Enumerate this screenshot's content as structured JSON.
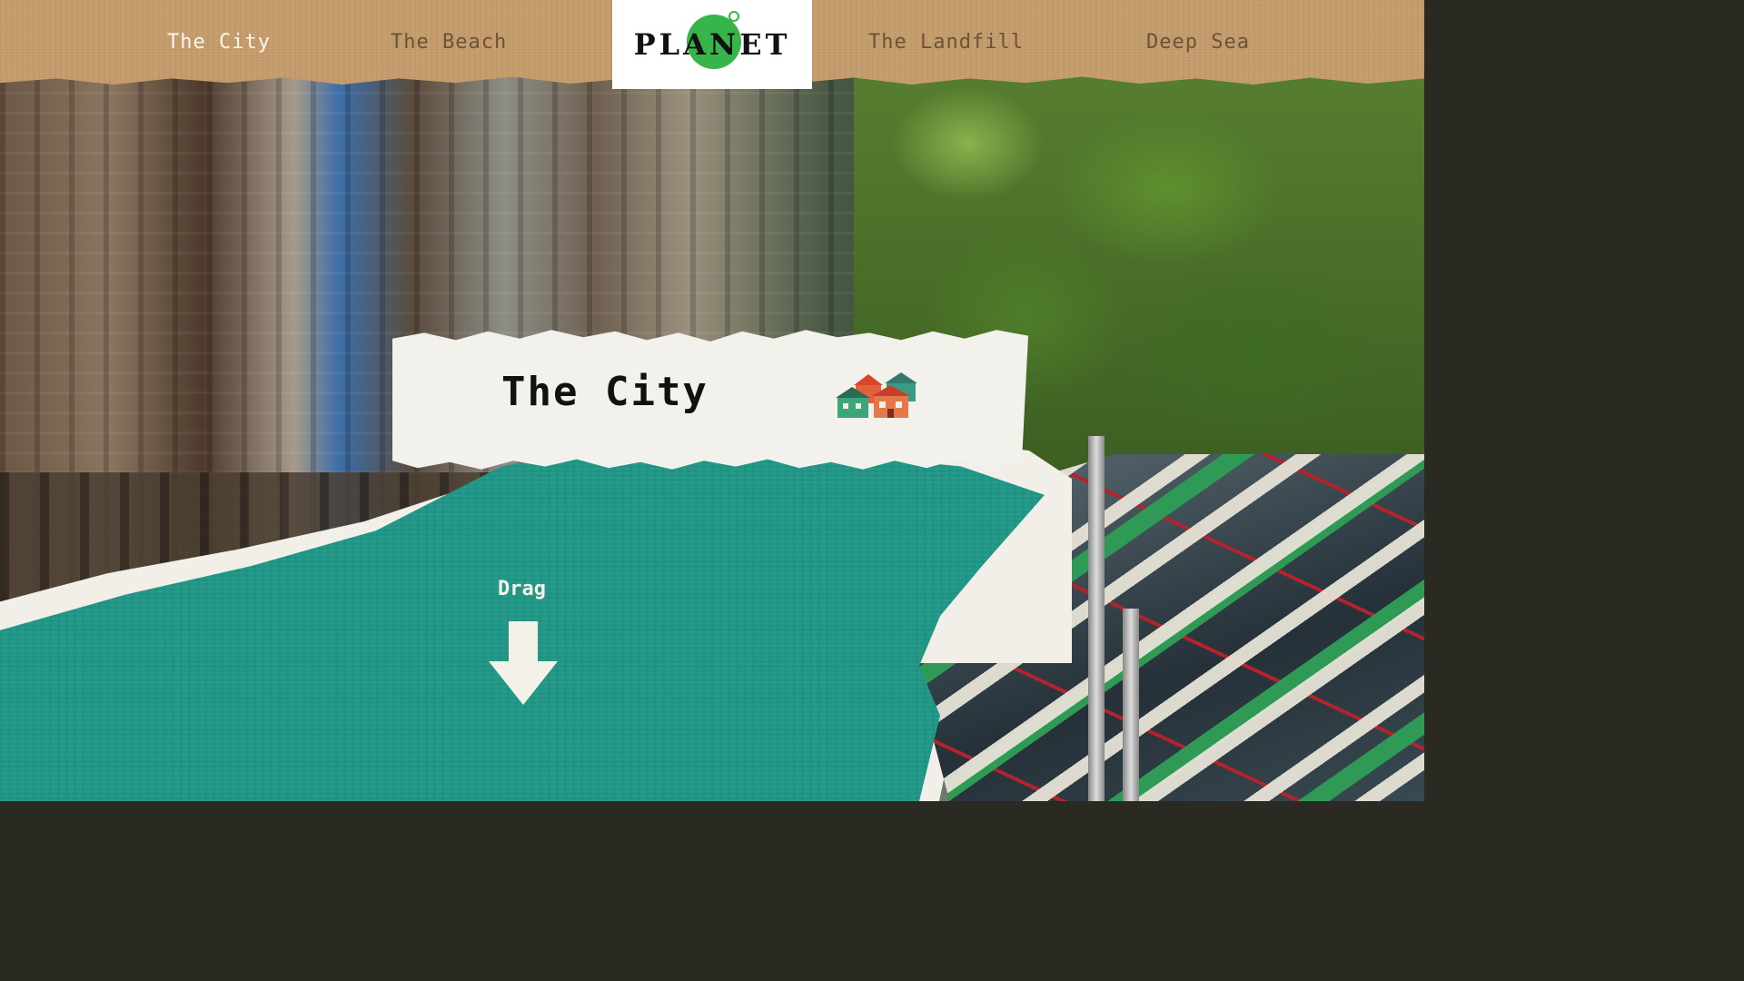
{
  "nav": {
    "items": [
      {
        "label": "The City",
        "active": true
      },
      {
        "label": "The Beach",
        "active": false
      },
      {
        "label": "The Landfill",
        "active": false
      },
      {
        "label": "Deep Sea",
        "active": false
      }
    ]
  },
  "logo": {
    "text": "PLANET"
  },
  "card": {
    "title": "The City",
    "icon": "houses-icon"
  },
  "drag": {
    "label": "Drag",
    "icon": "arrow-down-icon"
  },
  "colors": {
    "teal": "#1f9686",
    "kraft": "#c49c6c",
    "paper": "#f3f1ec",
    "logo_green": "#37b44a",
    "nav_active": "#fbf5ea",
    "nav_inactive": "#6e5236"
  }
}
